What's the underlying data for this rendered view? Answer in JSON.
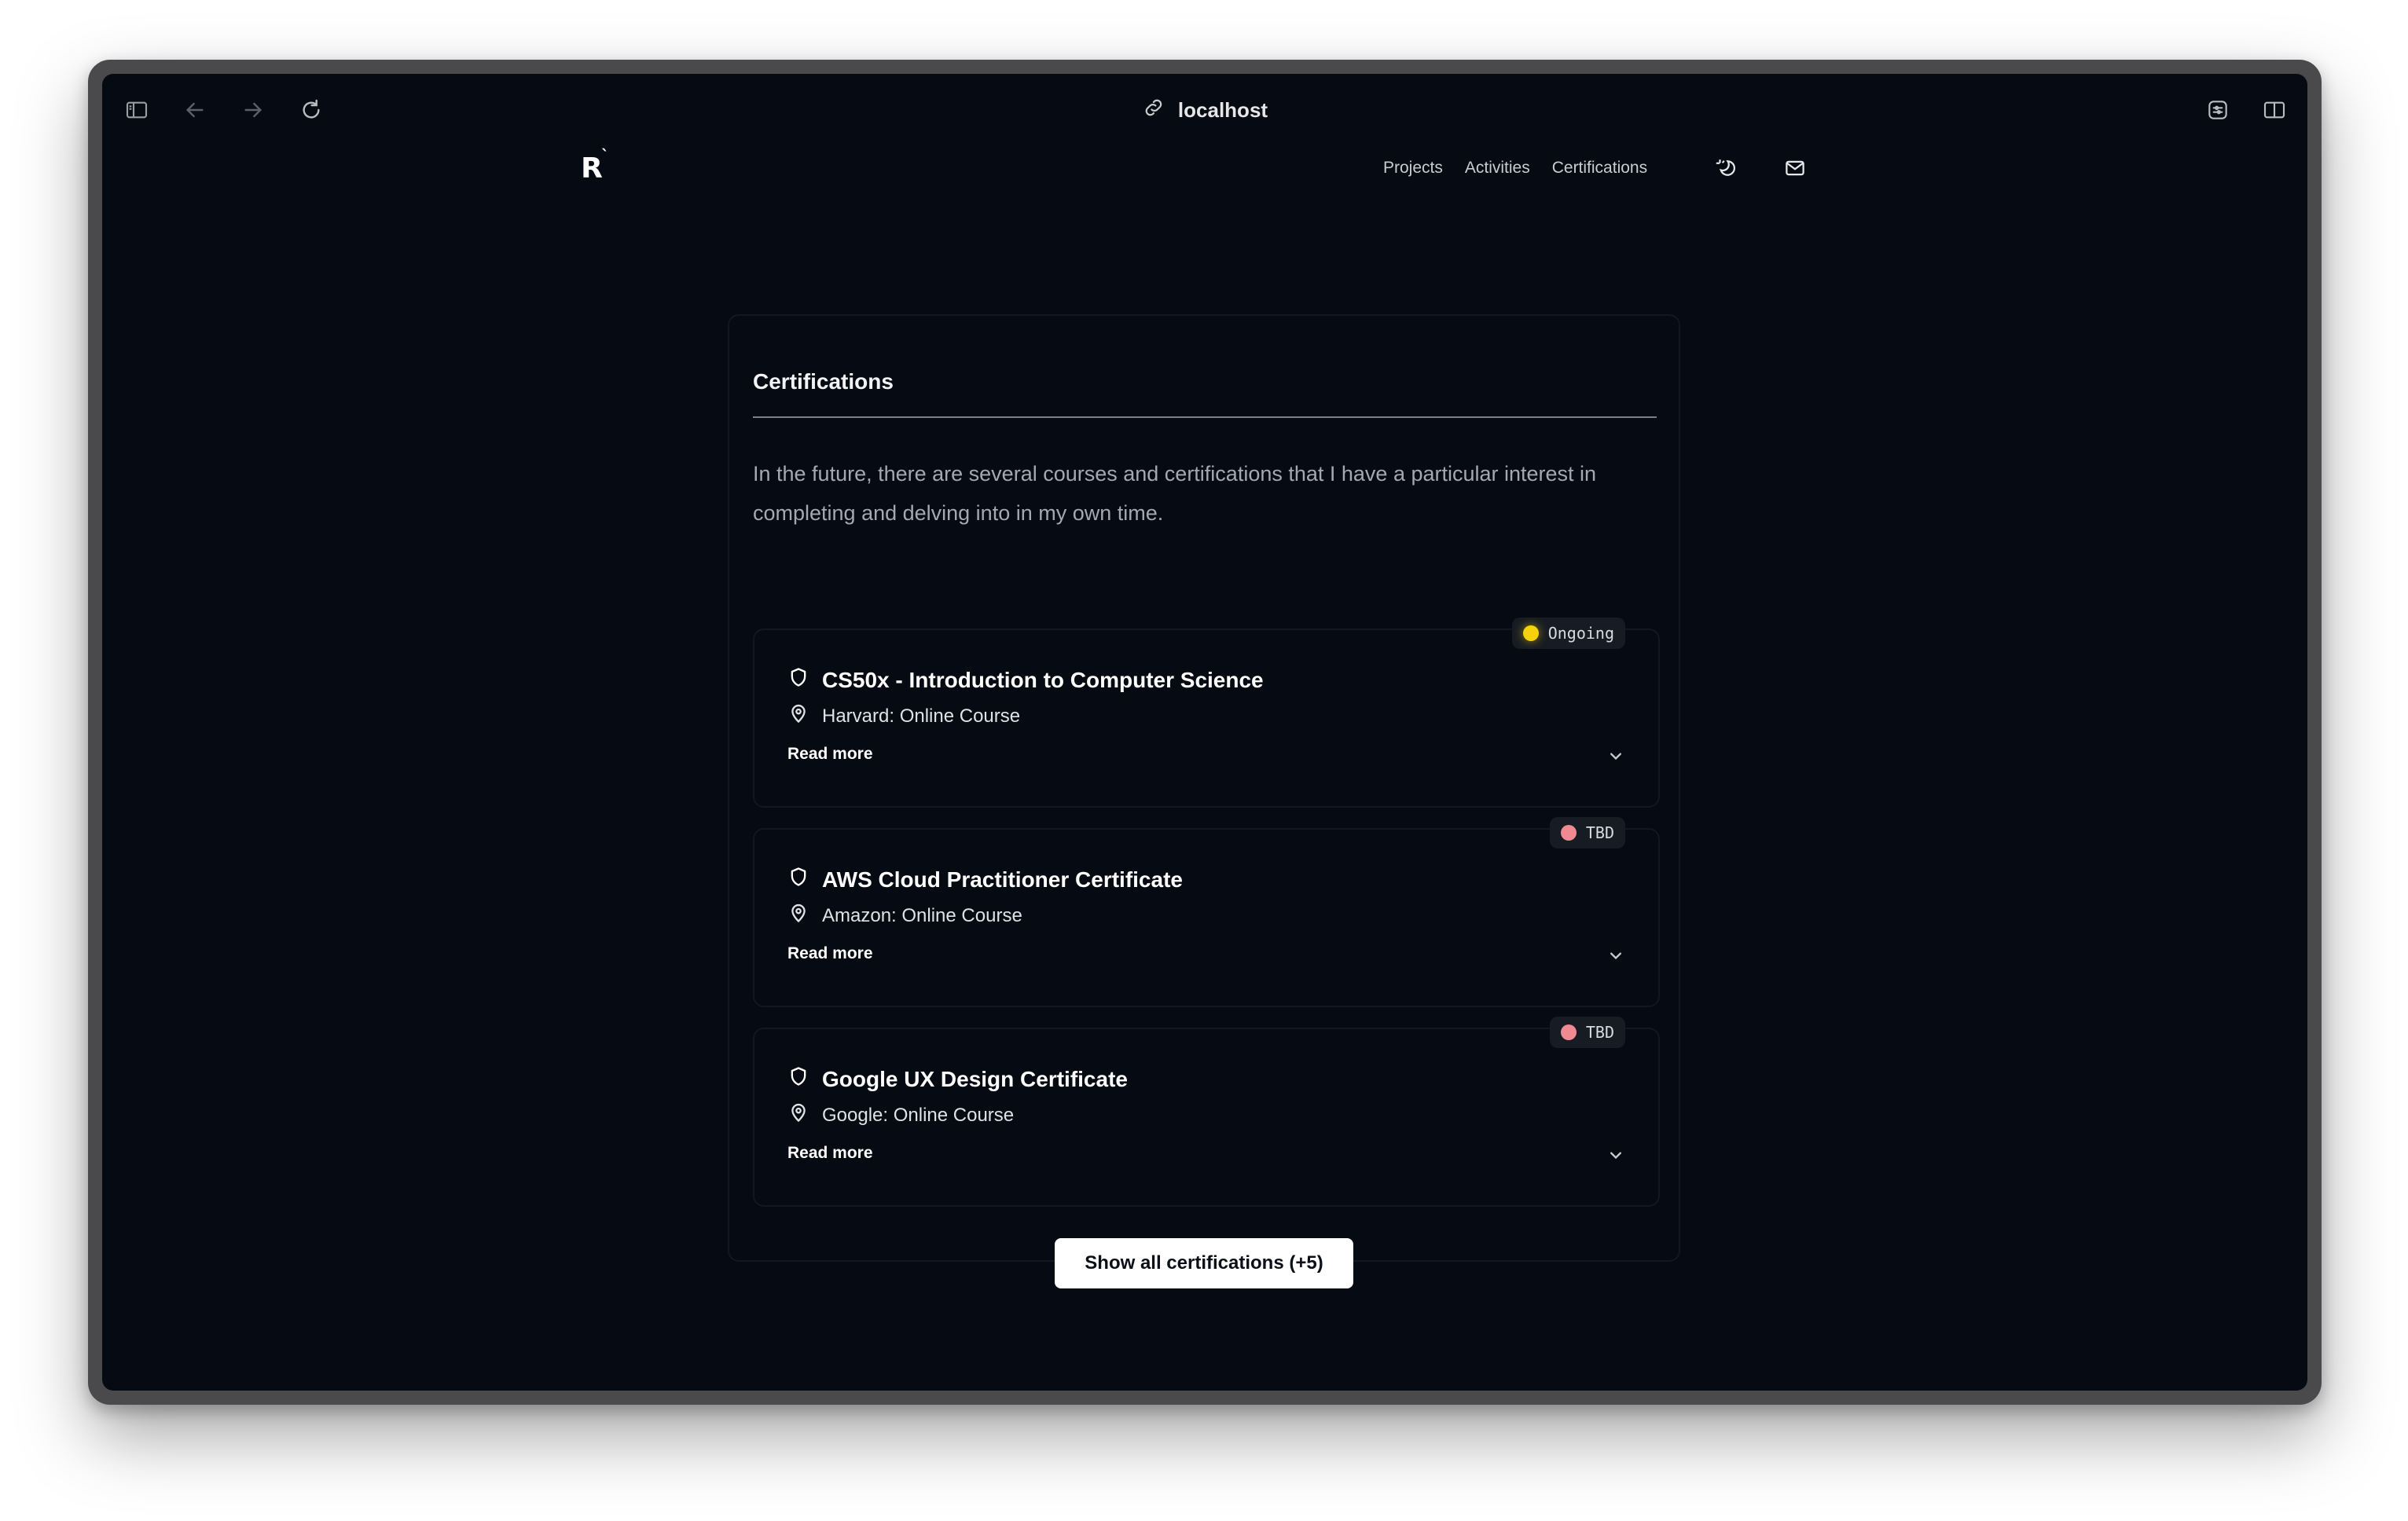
{
  "browser": {
    "url": "localhost",
    "icons": [
      "sidebar-icon",
      "back-icon",
      "forward-icon",
      "reload-icon",
      "link-icon",
      "extension-icon",
      "split-view-icon"
    ]
  },
  "site": {
    "logo_text": "R",
    "logo_mark": "`",
    "nav": {
      "projects": "Projects",
      "activities": "Activities",
      "certifications": "Certifications"
    },
    "icons": [
      "theme-toggle-icon",
      "mail-icon"
    ]
  },
  "section": {
    "title": "Certifications",
    "intro": "In the future, there are several courses and certifications that I have a particular interest in completing and delving into in my own time.",
    "items": [
      {
        "title": "CS50x - Introduction to Computer Science",
        "provider": "Harvard: Online Course",
        "read_more": "Read more",
        "status": "Ongoing",
        "status_color": "#f5d20c"
      },
      {
        "title": "AWS Cloud Practitioner Certificate",
        "provider": "Amazon: Online Course",
        "read_more": "Read more",
        "status": "TBD",
        "status_color": "#f08a92"
      },
      {
        "title": "Google UX Design Certificate",
        "provider": "Google: Online Course",
        "read_more": "Read more",
        "status": "TBD",
        "status_color": "#f08a92"
      }
    ],
    "show_all_label": "Show all certifications (+5)"
  },
  "colors": {
    "background": "#060a12",
    "text": "#ffffff",
    "muted_text": "#a4a8b1",
    "button_bg": "#ffffff"
  }
}
